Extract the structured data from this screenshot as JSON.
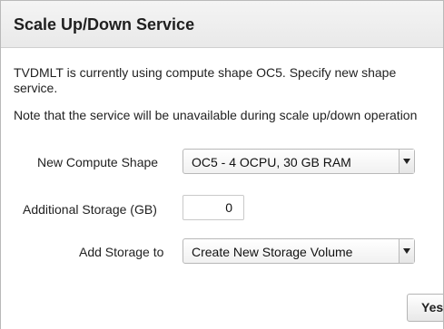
{
  "dialog": {
    "title": "Scale Up/Down Service",
    "intro_line1": "TVDMLT is currently using compute shape OC5. Specify new shape",
    "intro_line2": "service.",
    "note": "Note that the service will be unavailable during scale up/down operation"
  },
  "form": {
    "compute_shape": {
      "label": "New Compute Shape",
      "value": "OC5 - 4 OCPU, 30 GB RAM"
    },
    "additional_storage": {
      "label": "Additional Storage (GB)",
      "value": "0"
    },
    "add_storage_to": {
      "label": "Add Storage to",
      "value": "Create New Storage Volume"
    }
  },
  "actions": {
    "yes_label": "Yes"
  },
  "icons": {
    "dropdown": "chevron-down-icon"
  }
}
